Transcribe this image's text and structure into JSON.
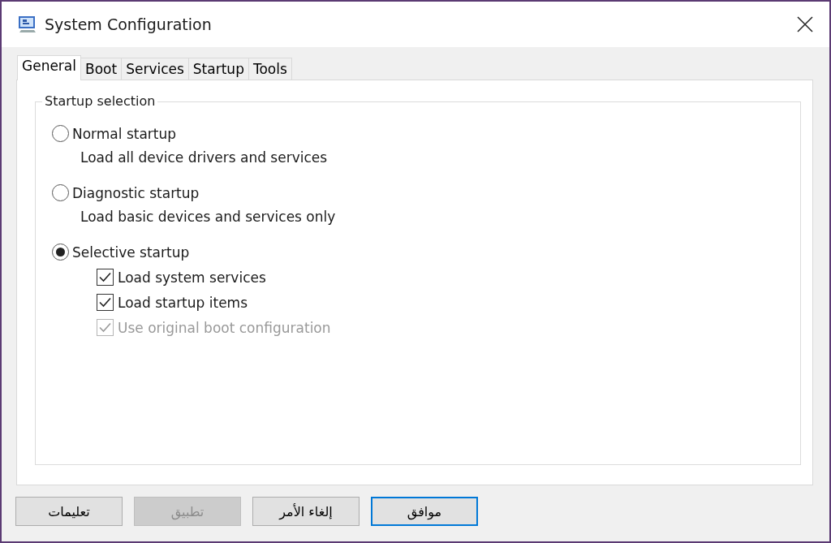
{
  "window": {
    "title": "System Configuration"
  },
  "tabs": [
    {
      "label": "General",
      "selected": true
    },
    {
      "label": "Boot",
      "selected": false
    },
    {
      "label": "Services",
      "selected": false
    },
    {
      "label": "Startup",
      "selected": false
    },
    {
      "label": "Tools",
      "selected": false
    }
  ],
  "group": {
    "title": "Startup selection",
    "options": [
      {
        "label": "Normal startup",
        "description": "Load all device drivers and services",
        "selected": false
      },
      {
        "label": "Diagnostic startup",
        "description": "Load basic devices and services only",
        "selected": false
      },
      {
        "label": "Selective startup",
        "selected": true,
        "checkboxes": [
          {
            "label": "Load system services",
            "checked": true,
            "disabled": false
          },
          {
            "label": "Load startup items",
            "checked": true,
            "disabled": false
          },
          {
            "label": "Use original boot configuration",
            "checked": true,
            "disabled": true
          }
        ]
      }
    ]
  },
  "buttons": [
    {
      "label": "موافق",
      "disabled": false,
      "default": true
    },
    {
      "label": "إلغاء الأمر",
      "disabled": false,
      "default": false
    },
    {
      "label": "تطبيق",
      "disabled": true,
      "default": false
    },
    {
      "label": "تعليمات",
      "disabled": false,
      "default": false
    }
  ]
}
